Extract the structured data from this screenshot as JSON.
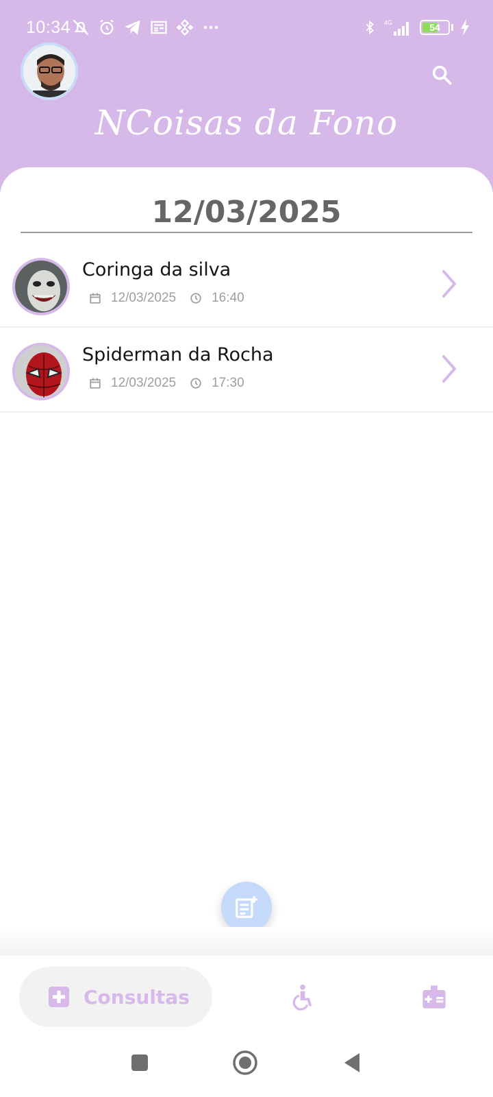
{
  "status_bar": {
    "time": "10:34",
    "battery_level": "54"
  },
  "header": {
    "app_title": "NCoisas da Fono"
  },
  "schedule": {
    "date_heading": "12/03/2025",
    "appointments": [
      {
        "name": "Coringa da silva",
        "date": "12/03/2025",
        "time": "16:40"
      },
      {
        "name": "Spiderman da Rocha",
        "date": "12/03/2025",
        "time": "17:30"
      }
    ]
  },
  "bottom_nav": {
    "consultas_label": "Consultas"
  },
  "colors": {
    "header_bg": "#d7b9e9",
    "accent_lilac": "#d7b9e9",
    "fab_bg": "#c5d9fb"
  }
}
